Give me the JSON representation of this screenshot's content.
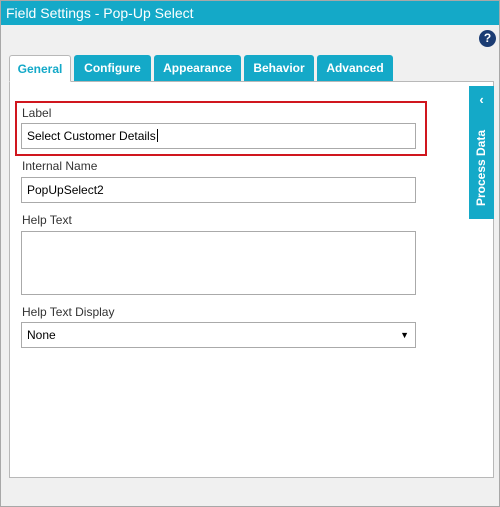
{
  "window": {
    "title": "Field Settings - Pop-Up Select"
  },
  "help_icon": {
    "glyph": "?"
  },
  "tabs": [
    {
      "label": "General",
      "active": true
    },
    {
      "label": "Configure",
      "active": false
    },
    {
      "label": "Appearance",
      "active": false
    },
    {
      "label": "Behavior",
      "active": false
    },
    {
      "label": "Advanced",
      "active": false
    }
  ],
  "form": {
    "label": {
      "caption": "Label",
      "value": "Select Customer Details"
    },
    "internal_name": {
      "caption": "Internal Name",
      "value": "PopUpSelect2"
    },
    "help_text": {
      "caption": "Help Text",
      "value": ""
    },
    "help_text_display": {
      "caption": "Help Text Display",
      "selected": "None"
    }
  },
  "side_panel": {
    "label": "Process Data",
    "chevron": "‹"
  },
  "colors": {
    "accent": "#14a9c8",
    "highlight": "#d0161e",
    "help_icon": "#1b3c73"
  }
}
